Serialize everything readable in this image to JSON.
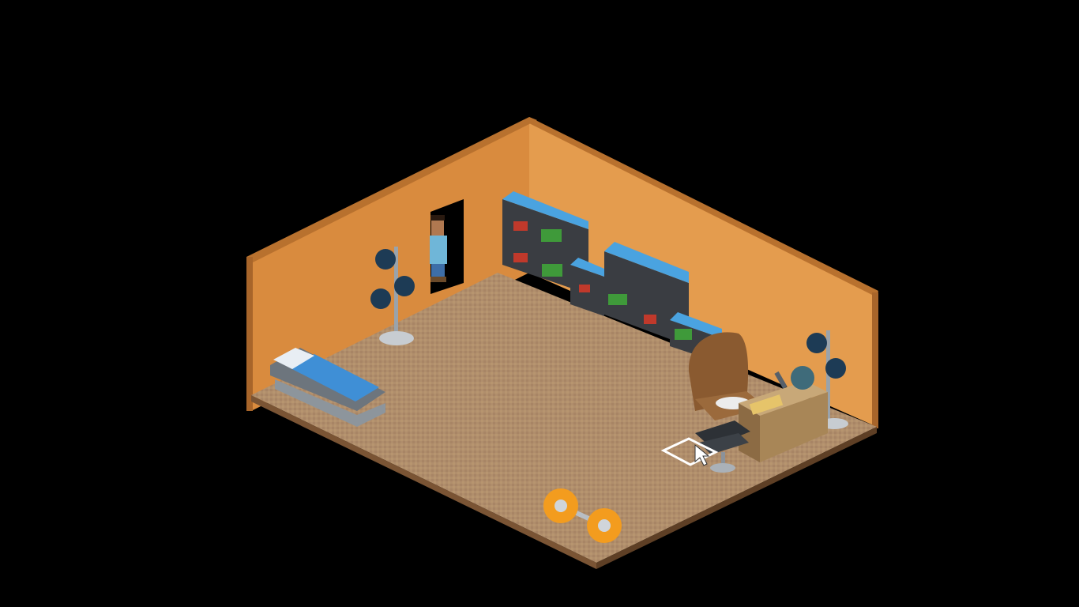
{
  "game": {
    "view": "isometric room",
    "colors": {
      "background": "#000000",
      "wall_left": "#d98b3e",
      "wall_right": "#e39a4c",
      "wall_top": "#b8712e",
      "floor": "#b08e6c",
      "floor_edge": "#7a5434",
      "shelf_frame": "#3a3d42",
      "shelf_screen": "#4aa3e0",
      "bed_sheet": "#3f8fd6",
      "barbell_plate": "#f39c1e"
    },
    "furniture": [
      {
        "id": "bookshelf",
        "icon": "bookshelf-icon"
      },
      {
        "id": "punching-bag-stand",
        "icon": "punching-bag-icon"
      },
      {
        "id": "bed",
        "icon": "bed-icon"
      },
      {
        "id": "throne-chair",
        "icon": "throne-icon"
      },
      {
        "id": "desk",
        "icon": "desk-icon"
      },
      {
        "id": "office-chair",
        "icon": "office-chair-icon"
      },
      {
        "id": "barbell",
        "icon": "barbell-icon"
      },
      {
        "id": "avatar",
        "icon": "avatar-icon"
      }
    ],
    "cursor": "pointer-cursor-icon",
    "tile_selection": "tile-highlight"
  }
}
